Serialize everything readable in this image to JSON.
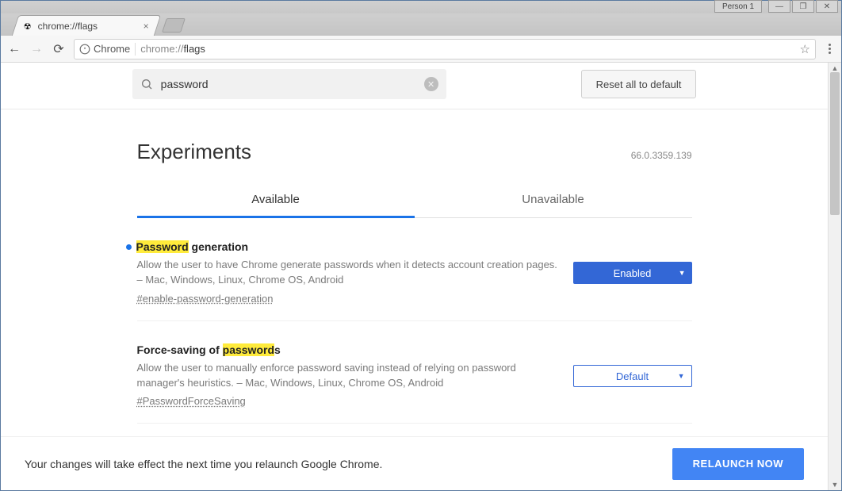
{
  "window": {
    "person_label": "Person 1"
  },
  "tab": {
    "title": "chrome://flags"
  },
  "omnibox": {
    "scheme_label": "Chrome",
    "url_prefix": "chrome://",
    "url_path": "flags"
  },
  "search": {
    "value": "password"
  },
  "reset_label": "Reset all to default",
  "page_title": "Experiments",
  "version": "66.0.3359.139",
  "tabs": {
    "available": "Available",
    "unavailable": "Unavailable"
  },
  "experiments": [
    {
      "title_hl": "Password",
      "title_rest": " generation",
      "modified": true,
      "description": "Allow the user to have Chrome generate passwords when it detects account creation pages. – Mac, Windows, Linux, Chrome OS, Android",
      "hash": "#enable-password-generation",
      "state": "Enabled",
      "state_style": "enabled"
    },
    {
      "title_pre": "Force-saving of ",
      "title_hl": "password",
      "title_post": "s",
      "modified": false,
      "description": "Allow the user to manually enforce password saving instead of relying on password manager's heuristics. – Mac, Windows, Linux, Chrome OS, Android",
      "hash": "#PasswordForceSaving",
      "state": "Default",
      "state_style": "default"
    }
  ],
  "relaunch": {
    "message": "Your changes will take effect the next time you relaunch Google Chrome.",
    "button": "RELAUNCH NOW"
  }
}
